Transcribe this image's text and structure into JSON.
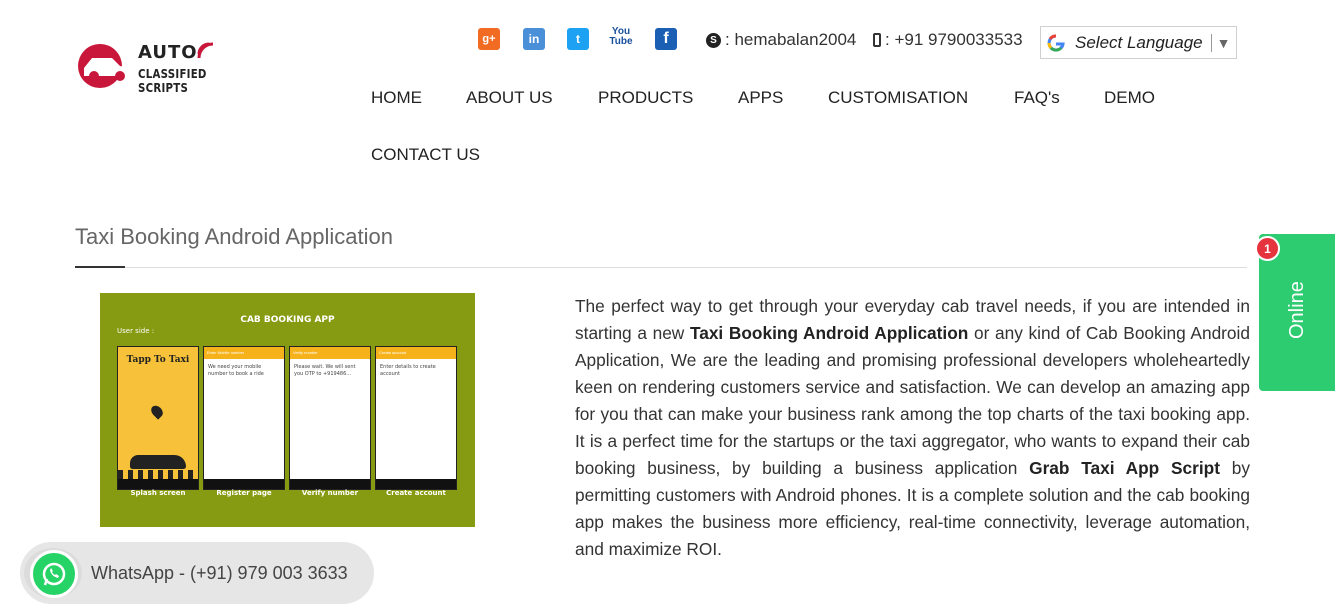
{
  "logo": {
    "title": "AUTO",
    "subtitle": "CLASSIFIED SCRIPTS"
  },
  "social": [
    {
      "icon": "google-plus-icon",
      "glyph": "g+"
    },
    {
      "icon": "linkedin-icon",
      "glyph": "in"
    },
    {
      "icon": "twitter-icon",
      "glyph": "t"
    },
    {
      "icon": "youtube-icon",
      "glyph_top": "You",
      "glyph_bottom": "Tube"
    },
    {
      "icon": "facebook-icon",
      "glyph": "f"
    }
  ],
  "contact": {
    "skype": ": hemabalan2004",
    "phone": ": +91 9790033533"
  },
  "language": {
    "label": "Select Language",
    "arrow": "▼"
  },
  "nav": [
    "HOME",
    "ABOUT US",
    "PRODUCTS",
    "APPS",
    "CUSTOMISATION",
    "FAQ's",
    "DEMO",
    "CONTACT US"
  ],
  "page": {
    "title": "Taxi Booking Android Application",
    "paragraph": {
      "p1": "The perfect way to get through your everyday cab travel needs, if you are intended in starting a new ",
      "b1": "Taxi Booking Android Application",
      "p2": " or any kind of Cab Booking Android Application, We are the leading and promising professional developers wholeheartedly keen on rendering customers service and satisfaction. We can develop an amazing app for you that can make your business rank among the top charts of the taxi booking app. It is a perfect time for the startups or the taxi aggregator, who wants to expand their cab booking business, by building a business application ",
      "b2": "Grab Taxi App Script",
      "p3": " by permitting customers with Android phones. It is a complete solution and the cab booking app makes the business more efficiency, real-time connectivity, leverage automation, and maximize ROI."
    }
  },
  "app_image": {
    "title": "CAB BOOKING APP",
    "user_side": "User side :",
    "splash_name": "Tapp To Taxi",
    "screens": [
      {
        "caption": "Splash screen"
      },
      {
        "caption": "Register page",
        "bar": "Enter Mobile number",
        "body": "We need your mobile number to book a ride"
      },
      {
        "caption": "Verify number",
        "bar": "Verify number",
        "body": "Please wait. We will sent you OTP to +919486..."
      },
      {
        "caption": "Create account",
        "bar": "Create account",
        "body": "Enter details to create account"
      }
    ]
  },
  "whatsapp": {
    "label": "WhatsApp - (+91) 979 003 3633"
  },
  "online": {
    "label": "Online",
    "badge": "1"
  },
  "colors": {
    "online_green": "#2ecc71",
    "whatsapp_green": "#25d366",
    "badge_red": "#e5343d",
    "image_green": "#879b12"
  }
}
